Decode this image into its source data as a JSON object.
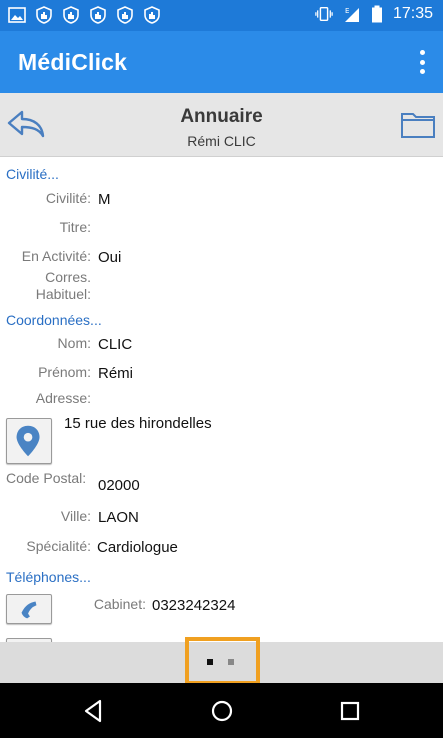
{
  "status_bar": {
    "time": "17:35",
    "icons": [
      "image-icon",
      "shield-icon",
      "shield-icon",
      "shield-icon",
      "shield-icon",
      "shield-icon",
      "vibrate-icon",
      "signal-icon",
      "battery-icon"
    ]
  },
  "app_bar": {
    "title": "MédiClick",
    "menu_icon": "overflow-menu-icon"
  },
  "header": {
    "title": "Annuaire",
    "subtitle": "Rémi CLIC",
    "back_icon": "reply-back-icon",
    "folder_icon": "folder-icon"
  },
  "sections": {
    "civilite": "Civilité...",
    "coordonnees": "Coordonnées...",
    "telephones": "Téléphones..."
  },
  "civilite": {
    "civilite_label": "Civilité:",
    "civilite_value": "M",
    "titre_label": "Titre:",
    "titre_value": "",
    "activite_label": "En Activité:",
    "activite_value": "Oui",
    "corres_label_1": "Corres.",
    "corres_label_2": "Habituel:",
    "corres_value": ""
  },
  "coordonnees": {
    "nom_label": "Nom:",
    "nom_value": "CLIC",
    "prenom_label": "Prénom:",
    "prenom_value": "Rémi",
    "adresse_label": "Adresse:",
    "adresse_value": "15 rue des hirondelles",
    "map_icon": "map-pin-icon",
    "cp_label": "Code Postal:",
    "cp_value": "02000",
    "ville_label": "Ville:",
    "ville_value": "LAON",
    "specialite_label": "Spécialité:",
    "specialite_value": "Cardiologue"
  },
  "telephones": {
    "cabinet_label": "Cabinet:",
    "cabinet_value": "0323242324",
    "phone_icon": "phone-icon"
  },
  "pager": {
    "pages": 2,
    "current": 1
  },
  "nav_bar": {
    "back": "nav-back-icon",
    "home": "nav-home-icon",
    "recents": "nav-recents-icon"
  },
  "colors": {
    "status_bar": "#1e7ad8",
    "app_bar": "#2b8be8",
    "section_link": "#2a6fc4",
    "highlight": "#f0a020"
  }
}
